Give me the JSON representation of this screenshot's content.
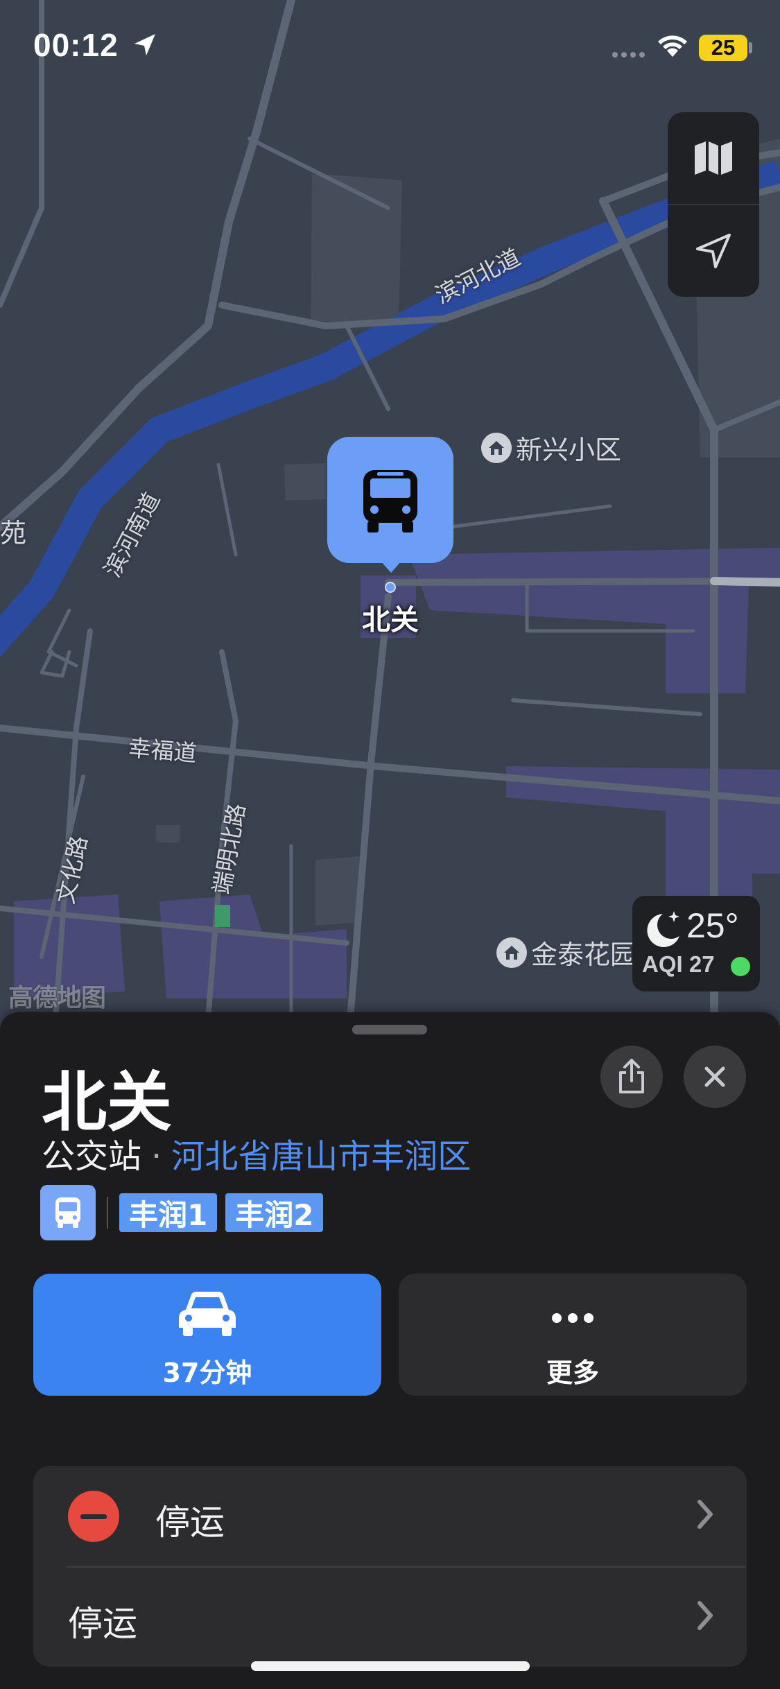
{
  "status_bar": {
    "time": "00:12",
    "battery": "25",
    "location_icon": "location-arrow-icon",
    "wifi_icon": "wifi-icon"
  },
  "map": {
    "controls": [
      {
        "icon": "map-icon"
      },
      {
        "icon": "location-icon"
      }
    ],
    "road_labels": [
      "滨河北道",
      "滨河南道",
      "幸福道",
      "文化路",
      "端明北路"
    ],
    "pois": [
      "新兴小区",
      "金泰花园"
    ],
    "edge_labels": [
      "苑"
    ],
    "selected_pin": {
      "label": "北关",
      "icon": "bus-icon"
    },
    "weather": {
      "temperature": "25°",
      "aqi": "AQI 27",
      "icon": "moon-stars-icon",
      "aqi_color": "#4cd964"
    },
    "brand": "高德地图",
    "colors": {
      "water": "#2a4aa0",
      "road": "#5c6573",
      "pin": "#6c9ef8"
    }
  },
  "sheet": {
    "title": "北关",
    "category": "公交站",
    "separator": "·",
    "region": "河北省唐山市丰润区",
    "routes": [
      "丰润1",
      "丰润2"
    ],
    "actions": [
      {
        "label": "37分钟",
        "icon": "car-icon"
      },
      {
        "label": "更多",
        "icon": "more-icon"
      }
    ],
    "list": [
      {
        "text": "停运",
        "icon": "stop-icon"
      },
      {
        "text": "停运"
      }
    ],
    "colors": {
      "accent": "#3a83f1",
      "region_link": "#4f8ef7",
      "stop_red": "#e8493f"
    }
  }
}
